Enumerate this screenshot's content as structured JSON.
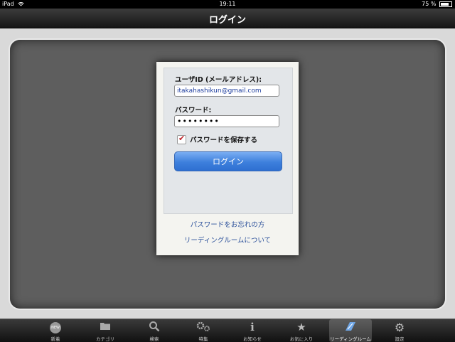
{
  "status": {
    "device": "iPad",
    "time": "19:11",
    "battery": "75 %",
    "battery_level": 0.75
  },
  "navbar": {
    "title": "ログイン"
  },
  "login": {
    "userid_label": "ユーザID (メールアドレス):",
    "userid_value": "itakahashikun@gmail.com",
    "password_label": "パスワード:",
    "password_value": "••••••••",
    "save_password_label": "パスワードを保存する",
    "login_button": "ログイン",
    "forgot_link": "パスワードをお忘れの方",
    "about_link": "リーディングルームについて"
  },
  "tabs": [
    {
      "label": "新着",
      "icon": "new-badge-icon",
      "glyph": "NEW"
    },
    {
      "label": "カテゴリ",
      "icon": "folder-icon",
      "glyph": "▬"
    },
    {
      "label": "検索",
      "icon": "search-icon",
      "glyph": "⚲"
    },
    {
      "label": "特集",
      "icon": "gears-icon",
      "glyph": "✲"
    },
    {
      "label": "お知らせ",
      "icon": "info-icon",
      "glyph": "i"
    },
    {
      "label": "お気に入り",
      "icon": "star-icon",
      "glyph": "★"
    },
    {
      "label": "リーディングルーム",
      "icon": "reading-room-icon",
      "glyph": "▰"
    },
    {
      "label": "設定",
      "icon": "gear-icon",
      "glyph": "⚙"
    }
  ],
  "colors": {
    "accent": "#3d7fdc",
    "link": "#2a4f9a",
    "check": "#c0272d"
  }
}
